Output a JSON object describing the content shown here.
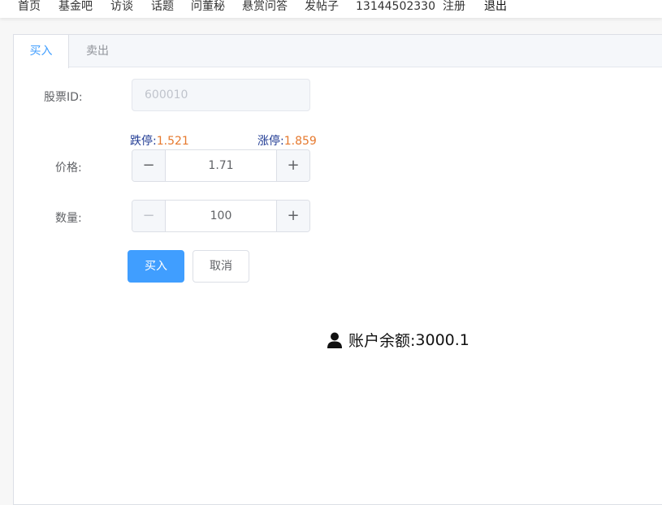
{
  "nav": {
    "items": [
      "首页",
      "基金吧",
      "访谈",
      "话题",
      "问董秘",
      "悬赏问答",
      "发帖子",
      "13144502330",
      "注册",
      "退出"
    ]
  },
  "tabs": {
    "buy": "买入",
    "sell": "卖出"
  },
  "form": {
    "stock_id_label": "股票ID:",
    "stock_id_value": "600010",
    "limit_down_label": "跌停:",
    "limit_down_value": "1.521",
    "limit_up_label": "涨停:",
    "limit_up_value": "1.859",
    "price_label": "价格:",
    "price_value": "1.71",
    "quantity_label": "数量:",
    "quantity_value": "100",
    "minus_symbol": "−",
    "plus_symbol": "+"
  },
  "actions": {
    "buy_label": "买入",
    "cancel_label": "取消"
  },
  "account": {
    "balance_label": "账户余额:",
    "balance_value": "3000.1",
    "icon": "user-icon"
  },
  "colors": {
    "accent": "#409eff",
    "limit_value": "#e6792e",
    "limit_label": "#1f3a93"
  }
}
